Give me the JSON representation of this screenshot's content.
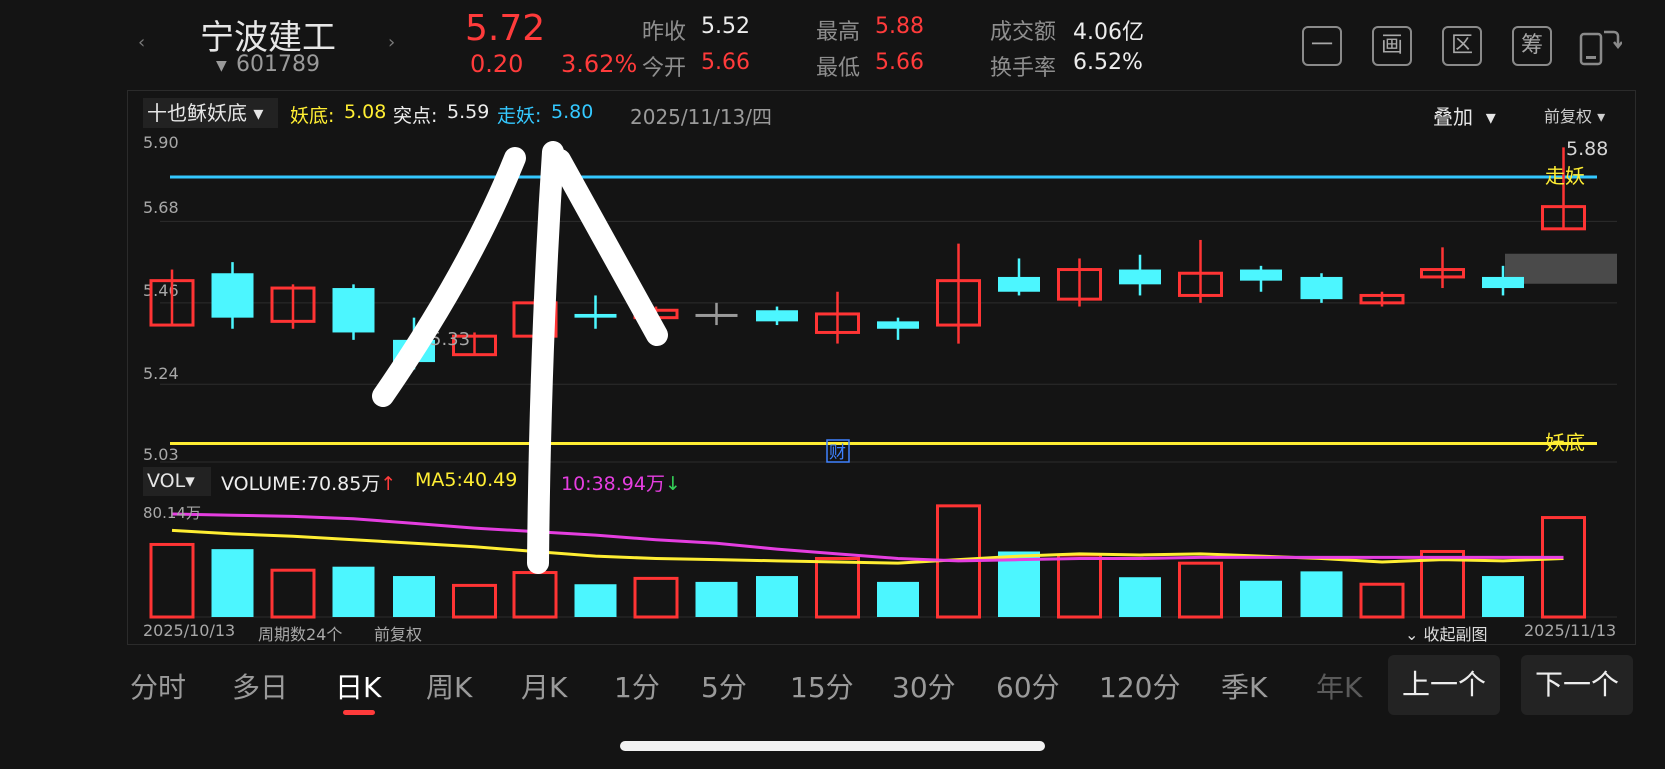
{
  "stock": {
    "name": "宁波建工",
    "code": "601789",
    "price": "5.72",
    "change": "0.20",
    "change_pct": "3.62%",
    "prev_close_label": "昨收",
    "prev_close": "5.52",
    "open_label": "今开",
    "open": "5.66",
    "high_label": "最高",
    "high": "5.88",
    "low_label": "最低",
    "low": "5.66",
    "turnover_amt_label": "成交额",
    "turnover_amt": "4.06亿",
    "turnover_rate_label": "换手率",
    "turnover_rate": "6.52%"
  },
  "toolbar": {
    "icons": [
      "一",
      "画",
      "区",
      "筹"
    ]
  },
  "indicator": {
    "selector": "十也稣妖底",
    "yaodi_label": "妖底:",
    "yaodi_value": "5.08",
    "tudian_label": "突点:",
    "tudian_value": "5.59",
    "zouyao_label": "走妖:",
    "zouyao_value": "5.80",
    "date": "2025/11/13/四",
    "overlay": "叠加",
    "fuquan": "前复权"
  },
  "volume_header": {
    "selector": "VOL",
    "volume_label": "VOLUME:",
    "volume_value": "70.85万",
    "ma5_label": "MA5:",
    "ma5_value": "40.49",
    "ma10_label": "10:",
    "ma10_value": "38.94万"
  },
  "chart_data": {
    "type": "candlestick",
    "y_ticks": [
      "5.90",
      "5.68",
      "5.46",
      "5.24",
      "5.03"
    ],
    "ylim": [
      5.03,
      5.9
    ],
    "candles": [
      {
        "o": 5.4,
        "c": 5.52,
        "h": 5.55,
        "l": 5.4,
        "color": "red"
      },
      {
        "o": 5.54,
        "c": 5.42,
        "h": 5.57,
        "l": 5.39,
        "color": "cyan"
      },
      {
        "o": 5.41,
        "c": 5.5,
        "h": 5.51,
        "l": 5.39,
        "color": "red"
      },
      {
        "o": 5.5,
        "c": 5.38,
        "h": 5.51,
        "l": 5.36,
        "color": "cyan"
      },
      {
        "o": 5.36,
        "c": 5.3,
        "h": 5.42,
        "l": 5.28,
        "color": "cyan"
      },
      {
        "o": 5.32,
        "c": 5.37,
        "h": 5.38,
        "l": 5.32,
        "color": "red"
      },
      {
        "o": 5.37,
        "c": 5.46,
        "h": 5.47,
        "l": 5.37,
        "color": "red"
      },
      {
        "o": 5.43,
        "c": 5.42,
        "h": 5.48,
        "l": 5.39,
        "color": "cyan"
      },
      {
        "o": 5.42,
        "c": 5.44,
        "h": 5.45,
        "l": 5.42,
        "color": "red"
      },
      {
        "o": 5.43,
        "c": 5.43,
        "h": 5.46,
        "l": 5.4,
        "color": "gray"
      },
      {
        "o": 5.44,
        "c": 5.41,
        "h": 5.45,
        "l": 5.4,
        "color": "cyan"
      },
      {
        "o": 5.38,
        "c": 5.43,
        "h": 5.49,
        "l": 5.35,
        "color": "red"
      },
      {
        "o": 5.41,
        "c": 5.39,
        "h": 5.42,
        "l": 5.36,
        "color": "cyan"
      },
      {
        "o": 5.4,
        "c": 5.52,
        "h": 5.62,
        "l": 5.35,
        "color": "red"
      },
      {
        "o": 5.53,
        "c": 5.49,
        "h": 5.58,
        "l": 5.48,
        "color": "cyan"
      },
      {
        "o": 5.47,
        "c": 5.55,
        "h": 5.58,
        "l": 5.45,
        "color": "red"
      },
      {
        "o": 5.55,
        "c": 5.51,
        "h": 5.59,
        "l": 5.48,
        "color": "cyan"
      },
      {
        "o": 5.48,
        "c": 5.54,
        "h": 5.63,
        "l": 5.46,
        "color": "red"
      },
      {
        "o": 5.55,
        "c": 5.52,
        "h": 5.56,
        "l": 5.49,
        "color": "cyan"
      },
      {
        "o": 5.53,
        "c": 5.47,
        "h": 5.54,
        "l": 5.46,
        "color": "cyan"
      },
      {
        "o": 5.46,
        "c": 5.48,
        "h": 5.49,
        "l": 5.45,
        "color": "red"
      },
      {
        "o": 5.53,
        "c": 5.55,
        "h": 5.61,
        "l": 5.5,
        "color": "red"
      },
      {
        "o": 5.53,
        "c": 5.5,
        "h": 5.56,
        "l": 5.48,
        "color": "cyan"
      },
      {
        "o": 5.66,
        "c": 5.72,
        "h": 5.88,
        "l": 5.66,
        "color": "red"
      }
    ],
    "low_label": "5.33",
    "high_label": "5.88",
    "zouyao_line": 5.8,
    "yaodi_line": 5.08,
    "zouyao_tag": "走妖",
    "yaodi_tag": "妖底",
    "cai_tag": "财",
    "volume": {
      "max_label": "80.14万",
      "values": [
        62,
        58,
        40,
        43,
        35,
        27,
        38,
        28,
        33,
        30,
        35,
        50,
        30,
        95,
        56,
        53,
        34,
        46,
        31,
        39,
        28,
        56,
        35,
        85
      ],
      "ma5": [
        74,
        71,
        69,
        66,
        63,
        60,
        56,
        52,
        50,
        49,
        48,
        47,
        46,
        49,
        52,
        54,
        53,
        54,
        52,
        50,
        47,
        49,
        48,
        50
      ],
      "ma10": [
        88,
        87,
        86,
        84,
        80,
        76,
        73,
        70,
        66,
        63,
        58,
        54,
        50,
        48,
        49,
        50,
        50,
        51,
        51,
        51,
        51,
        51,
        51,
        51
      ],
      "ymax": 100
    },
    "bottom_left_date": "2025/10/13",
    "period_count": "周期数24个",
    "bottom_fuquan": "前复权",
    "collapse": "收起副图",
    "bottom_right_date": "2025/11/13"
  },
  "tabs": [
    "分时",
    "多日",
    "日K",
    "周K",
    "月K",
    "1分",
    "5分",
    "15分",
    "30分",
    "60分",
    "120分",
    "季K",
    "年K"
  ],
  "active_tab": "日K",
  "prev_button": "上一个",
  "next_button": "下一个"
}
